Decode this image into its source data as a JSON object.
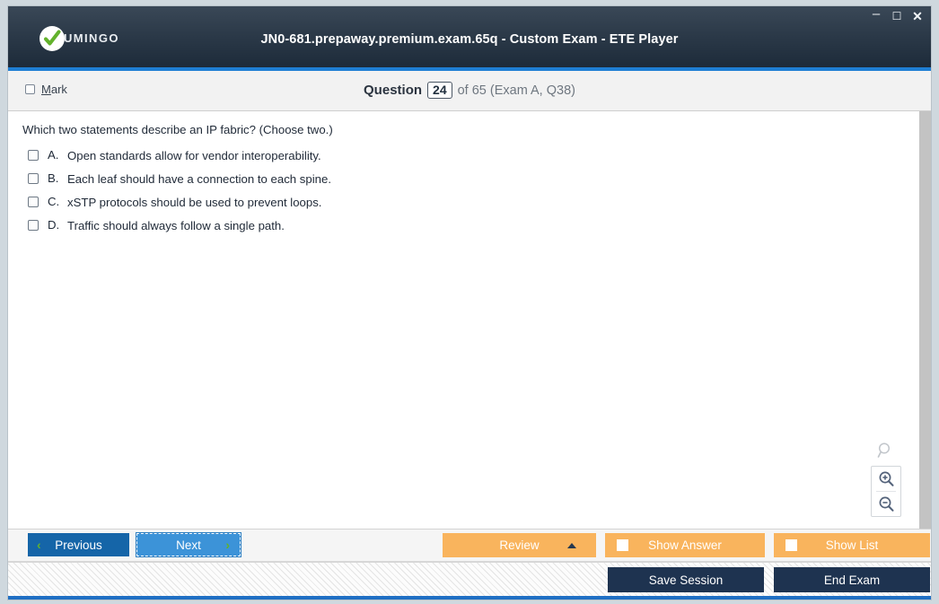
{
  "window": {
    "title": "JN0-681.prepaway.premium.exam.65q - Custom Exam - ETE Player",
    "logo_text": "UMINGO",
    "controls": {
      "minimize": "–",
      "maximize": "☐",
      "close": "✕"
    },
    "accent_blue": "#1f7fd4",
    "titlebar_dark": "#2c3a49"
  },
  "question_bar": {
    "mark_label_prefix": "",
    "mark_accel": "M",
    "mark_label_rest": "ark",
    "question_word": "Question",
    "question_number": "24",
    "question_rest": "of 65 (Exam A, Q38)"
  },
  "question": {
    "stem": "Which two statements describe an IP fabric? (Choose two.)",
    "options": [
      {
        "letter": "A.",
        "text": "Open standards allow for vendor interoperability.",
        "checked": false
      },
      {
        "letter": "B.",
        "text": "Each leaf should have a connection to each spine.",
        "checked": false
      },
      {
        "letter": "C.",
        "text": "xSTP protocols should be used to prevent loops.",
        "checked": false
      },
      {
        "letter": "D.",
        "text": "Traffic should always follow a single path.",
        "checked": false
      }
    ]
  },
  "zoom_widget": {
    "search_icon": "magnifier-icon",
    "zoom_in_icon": "magnifier-plus-icon",
    "zoom_out_icon": "magnifier-minus-icon"
  },
  "nav_bar": {
    "previous_label": "Previous",
    "previous_chevron": "‹",
    "next_label": "Next",
    "next_chevron": "›",
    "review_label": "Review",
    "show_answer_label": "Show Answer",
    "show_list_label": "Show List",
    "orange_color": "#f9b45d",
    "previous_color": "#1565a8",
    "next_color": "#3c93d8",
    "chevron_color": "#62b22b"
  },
  "status_bar": {
    "save_session_label": "Save Session",
    "end_exam_label": "End Exam",
    "dark_button_color": "#1e3350"
  }
}
